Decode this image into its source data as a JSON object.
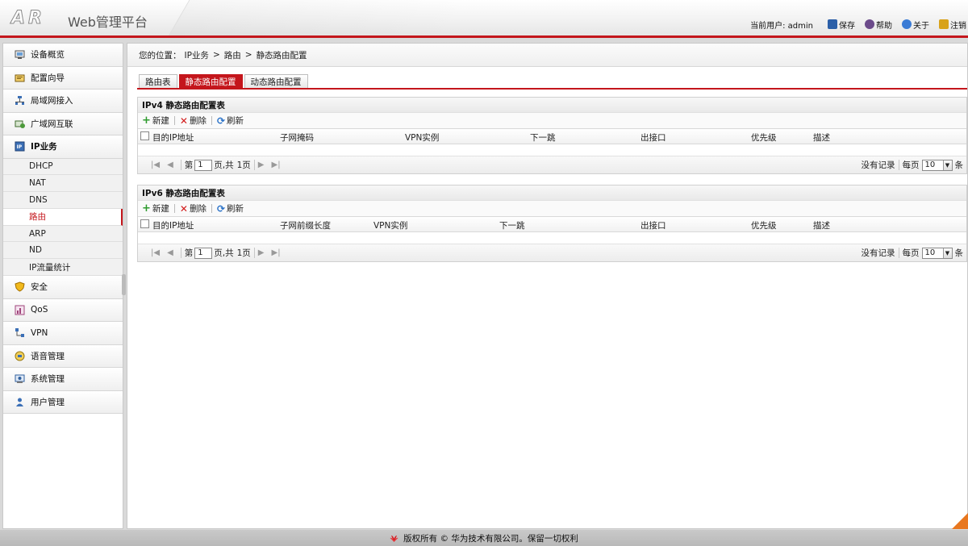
{
  "header": {
    "logo": "AR",
    "title": "Web管理平台",
    "current_user": "当前用户: admin",
    "links": [
      {
        "label": "保存",
        "icon": "save-icon",
        "color": "#2b5fa8"
      },
      {
        "label": "帮助",
        "icon": "help-icon",
        "color": "#6b4a8a"
      },
      {
        "label": "关于",
        "icon": "about-icon",
        "color": "#3a7bd5"
      },
      {
        "label": "注销",
        "icon": "logout-icon",
        "color": "#d8a21a"
      }
    ]
  },
  "sidebar": {
    "items": [
      {
        "label": "设备概览",
        "icon": "device-overview-icon"
      },
      {
        "label": "配置向导",
        "icon": "wizard-icon"
      },
      {
        "label": "局域网接入",
        "icon": "lan-icon"
      },
      {
        "label": "广域网互联",
        "icon": "wan-icon"
      },
      {
        "label": "IP业务",
        "icon": "ip-service-icon"
      }
    ],
    "subitems": [
      "DHCP",
      "NAT",
      "DNS",
      "路由",
      "ARP",
      "ND",
      "IP流量统计"
    ],
    "active_subitem": "路由",
    "items_after": [
      {
        "label": "安全",
        "icon": "shield-icon"
      },
      {
        "label": "QoS",
        "icon": "qos-icon"
      },
      {
        "label": "VPN",
        "icon": "vpn-icon"
      },
      {
        "label": "语音管理",
        "icon": "voice-icon"
      },
      {
        "label": "系统管理",
        "icon": "system-icon"
      },
      {
        "label": "用户管理",
        "icon": "user-icon"
      }
    ]
  },
  "breadcrumb": {
    "prefix": "您的位置：",
    "parts": [
      "IP业务",
      "路由",
      "静态路由配置"
    ],
    "sep": ">"
  },
  "tabs": [
    {
      "label": "路由表",
      "active": false
    },
    {
      "label": "静态路由配置",
      "active": true
    },
    {
      "label": "动态路由配置",
      "active": false
    }
  ],
  "toolbar": {
    "new": "新建",
    "delete": "删除",
    "refresh": "刷新"
  },
  "ipv4": {
    "title": "IPv4 静态路由配置表",
    "columns": [
      "目的IP地址",
      "子网掩码",
      "VPN实例",
      "下一跳",
      "出接口",
      "优先级",
      "描述"
    ]
  },
  "ipv6": {
    "title": "IPv6 静态路由配置表",
    "columns": [
      "目的IP地址",
      "子网前缀长度",
      "VPN实例",
      "下一跳",
      "出接口",
      "优先级",
      "描述"
    ]
  },
  "pager": {
    "page_prefix": "第",
    "page_value": "1",
    "page_suffix": "页,共",
    "total": "1页",
    "no_records": "没有记录",
    "per_page": "每页",
    "per_page_value": "10",
    "unit": "条"
  },
  "footer": {
    "text": "版权所有 © 华为技术有限公司。保留一切权利"
  },
  "colors": {
    "accent": "#c4161c",
    "orange": "#e8771f"
  }
}
